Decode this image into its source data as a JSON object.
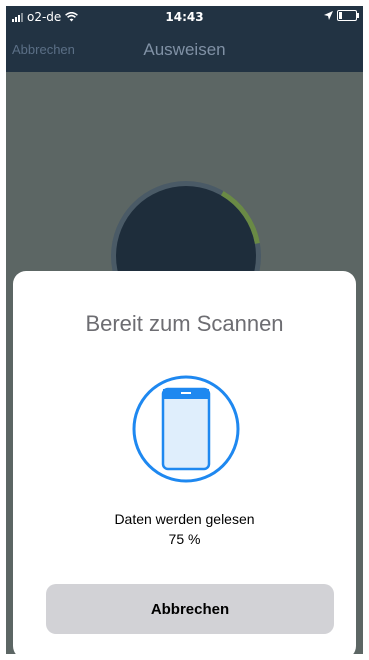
{
  "status_bar": {
    "carrier": "o2-de",
    "time": "14:43"
  },
  "nav": {
    "cancel_label": "Abbrechen",
    "title": "Ausweisen"
  },
  "scan_sheet": {
    "title": "Bereit zum Scannen",
    "status": "Daten werden gelesen",
    "progress_text": "75 %",
    "progress_fraction": 0.75,
    "cancel_label": "Abbrechen"
  },
  "colors": {
    "nav_background": "#223343",
    "accent": "#1e88f0",
    "ring_progress": "#6a8a45"
  },
  "icons": [
    "signal-icon",
    "wifi-icon",
    "location-arrow-icon",
    "battery-icon",
    "phone-icon"
  ]
}
